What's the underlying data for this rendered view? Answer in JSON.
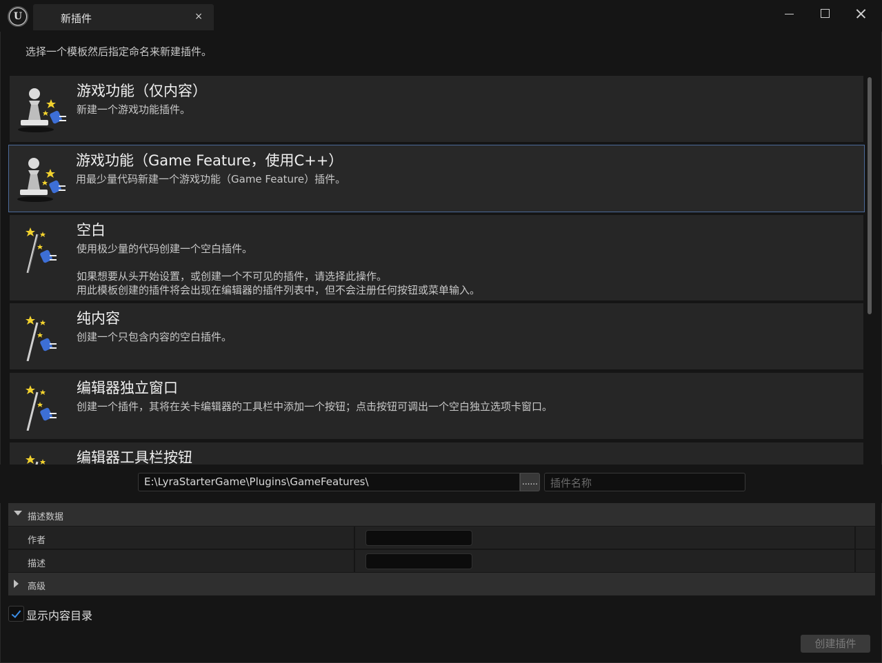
{
  "window": {
    "tab_label": "新插件",
    "tab_close": "×"
  },
  "instructions": "选择一个模板然后指定命名来新建插件。",
  "templates": [
    {
      "title": "游戏功能（仅内容）",
      "desc": "新建一个游戏功能插件。",
      "icon": "pawn-plugin-icon"
    },
    {
      "title": "游戏功能（Game Feature，使用C++）",
      "desc": "用最少量代码新建一个游戏功能（Game Feature）插件。",
      "icon": "pawn-plugin-icon",
      "selected": true
    },
    {
      "title": "空白",
      "desc": "使用极少量的代码创建一个空白插件。\n\n如果想要从头开始设置，或创建一个不可见的插件，请选择此操作。\n用此模板创建的插件将会出现在编辑器的插件列表中，但不会注册任何按钮或菜单输入。",
      "icon": "magic-wand-plugin-icon"
    },
    {
      "title": "纯内容",
      "desc": "创建一个只包含内容的空白插件。",
      "icon": "magic-wand-plugin-icon"
    },
    {
      "title": "编辑器独立窗口",
      "desc": "创建一个插件，其将在关卡编辑器的工具栏中添加一个按钮；点击按钮可调出一个空白独立选项卡窗口。",
      "icon": "magic-wand-plugin-icon"
    },
    {
      "title": "编辑器工具栏按钮",
      "desc": "",
      "icon": "magic-wand-plugin-icon"
    }
  ],
  "path": {
    "value": "E:\\LyraStarterGame\\Plugins\\GameFeatures\\",
    "browse_label": "......",
    "name_placeholder": "插件名称"
  },
  "details": {
    "metadata_header": "描述数据",
    "author_label": "作者",
    "description_label": "描述",
    "advanced_header": "高级"
  },
  "show_content_dir": {
    "label": "显示内容目录",
    "checked": true
  },
  "create_button": "创建插件",
  "colors": {
    "accent": "#3b8ee8",
    "selection_border": "#4c6a9a"
  }
}
